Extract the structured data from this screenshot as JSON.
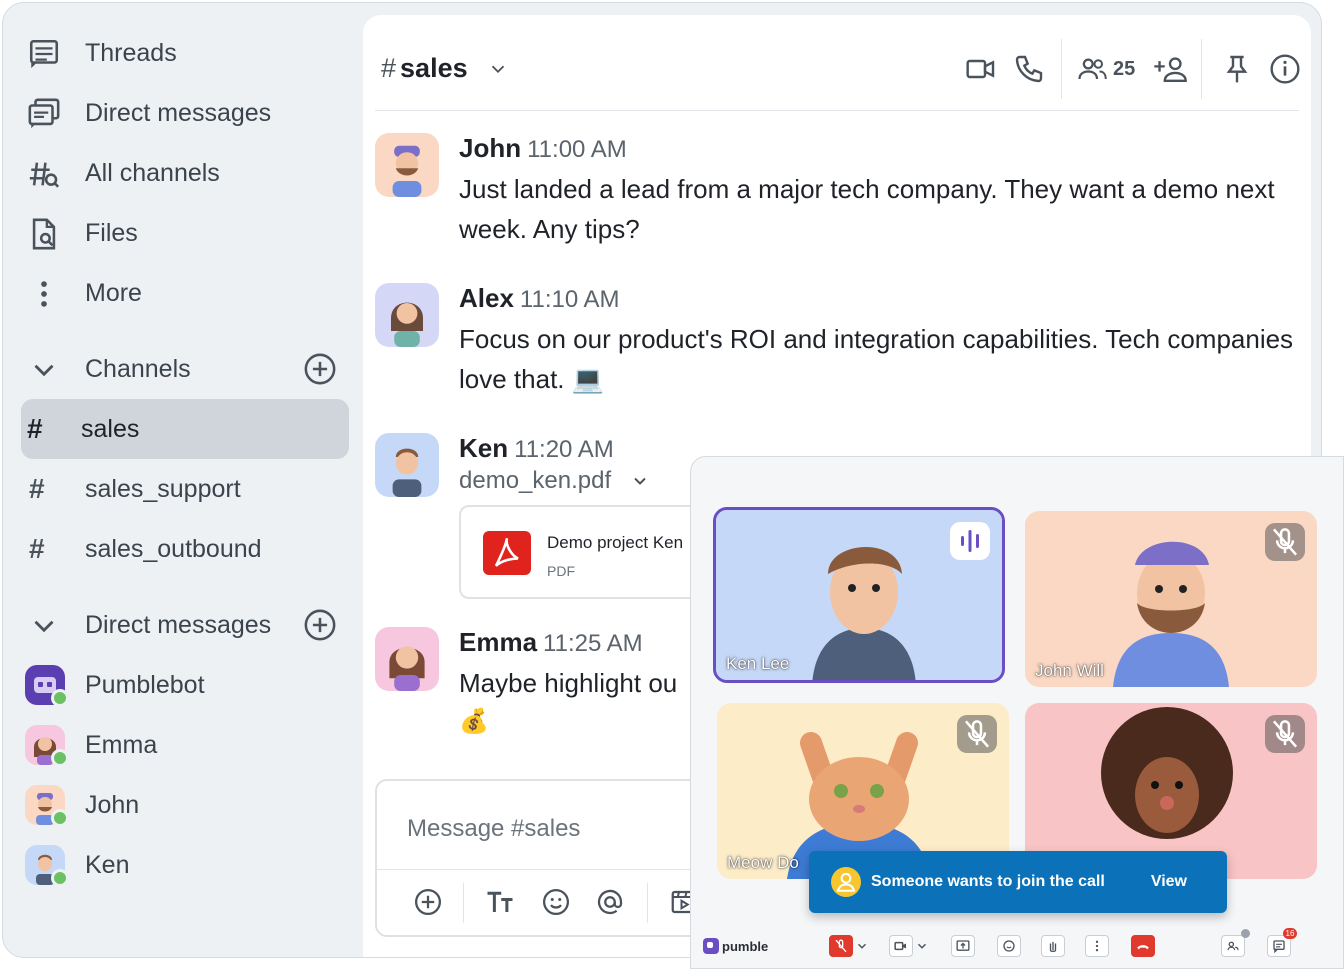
{
  "sidebar": {
    "nav": [
      {
        "label": "Threads",
        "icon": "threads-icon"
      },
      {
        "label": "Direct messages",
        "icon": "direct-messages-icon"
      },
      {
        "label": "All channels",
        "icon": "channel-search-icon"
      },
      {
        "label": "Files",
        "icon": "files-icon"
      },
      {
        "label": "More",
        "icon": "more-vertical-icon"
      }
    ],
    "channels_header": "Channels",
    "channels": [
      "sales",
      "sales_support",
      "sales_outbound"
    ],
    "active_channel": "sales",
    "dms_header": "Direct messages",
    "dms": [
      "Pumblebot",
      "Emma",
      "John",
      "Ken"
    ]
  },
  "header": {
    "hash": "#",
    "channel": "sales",
    "member_count": "25"
  },
  "messages": [
    {
      "author": "John",
      "time": "11:00 AM",
      "text": "Just landed a lead from a major tech company. They want a demo next week. Any tips?"
    },
    {
      "author": "Alex",
      "time": "11:10 AM",
      "text": "Focus on our product's ROI and integration capabilities. Tech companies love that. 💻"
    },
    {
      "author": "Ken",
      "time": "11:20 AM",
      "file_name": "demo_ken.pdf",
      "card_title": "Demo project Ken",
      "card_type": "PDF"
    },
    {
      "author": "Emma",
      "time": "11:25 AM",
      "text": "Maybe highlight ou",
      "emoji": "💰"
    }
  ],
  "composer": {
    "placeholder": "Message #sales"
  },
  "call": {
    "participants": [
      {
        "name": "Ken Lee",
        "bg": "#c6d8f7",
        "speaking": true
      },
      {
        "name": "John Will",
        "bg": "#fad8c4",
        "speaking": false
      },
      {
        "name": "Meow Do",
        "bg": "#fdecc8",
        "speaking": false
      },
      {
        "name": "",
        "bg": "#f9c4c6",
        "speaking": false
      }
    ],
    "toast": {
      "text": "Someone wants to join the call",
      "action": "View"
    },
    "brand": "pumble",
    "badge_chat": "16"
  },
  "colors": {
    "accent": "#0b72b9",
    "speaking_border": "#6a4fc4",
    "online": "#6cc164",
    "hangup": "#e03a2e"
  }
}
